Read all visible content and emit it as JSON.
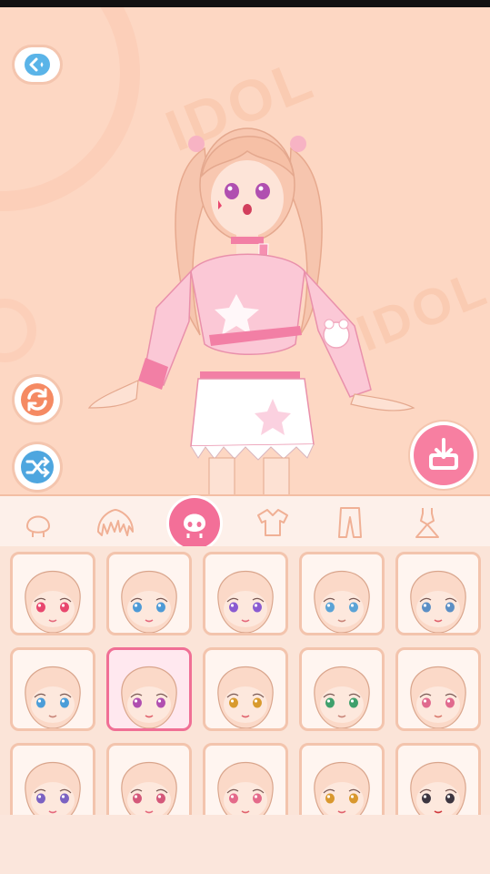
{
  "watermarks": [
    "IDOL",
    "IDOL"
  ],
  "icons": {
    "back": "back-arrow-icon",
    "refresh": "refresh-icon",
    "shuffle": "shuffle-icon",
    "save": "download-save-icon"
  },
  "tabs": [
    {
      "id": "head",
      "icon": "head-icon",
      "active": false
    },
    {
      "id": "hair",
      "icon": "hair-icon",
      "active": false
    },
    {
      "id": "face",
      "icon": "face-icon",
      "active": true
    },
    {
      "id": "top",
      "icon": "top-icon",
      "active": false
    },
    {
      "id": "pants",
      "icon": "pants-icon",
      "active": false
    },
    {
      "id": "dress",
      "icon": "dress-icon",
      "active": false
    }
  ],
  "face_options": [
    {
      "eye": "#e8476e",
      "mouth": "#e56a7e",
      "selected": false
    },
    {
      "eye": "#4d9ad6",
      "mouth": "#e56a7e",
      "selected": false
    },
    {
      "eye": "#8a5bd1",
      "mouth": "#e56a7e",
      "selected": false
    },
    {
      "eye": "#5aa3d6",
      "mouth": "#c9867a",
      "selected": false
    },
    {
      "eye": "#5b8fc5",
      "mouth": "#e0636e",
      "selected": false
    },
    {
      "eye": "#4b9dd8",
      "mouth": "#c9867a",
      "selected": false
    },
    {
      "eye": "#b04fb0",
      "mouth": "#e0636e",
      "selected": true
    },
    {
      "eye": "#d89a2e",
      "mouth": "#e0636e",
      "selected": false
    },
    {
      "eye": "#3fa06c",
      "mouth": "#c9867a",
      "selected": false
    },
    {
      "eye": "#e06a8e",
      "mouth": "#d97a6e",
      "selected": false
    },
    {
      "eye": "#7b62c2",
      "mouth": "#e56a7e",
      "selected": false
    },
    {
      "eye": "#d4587a",
      "mouth": "#e56a7e",
      "selected": false
    },
    {
      "eye": "#e46a8a",
      "mouth": "#e0636e",
      "selected": false
    },
    {
      "eye": "#d9982e",
      "mouth": "#e0636e",
      "selected": false
    },
    {
      "eye": "#3c3540",
      "mouth": "#d0393f",
      "selected": false
    }
  ],
  "colors": {
    "accent": "#f36f98",
    "background": "#fdd7c3",
    "card_border": "#f3c4ad"
  }
}
